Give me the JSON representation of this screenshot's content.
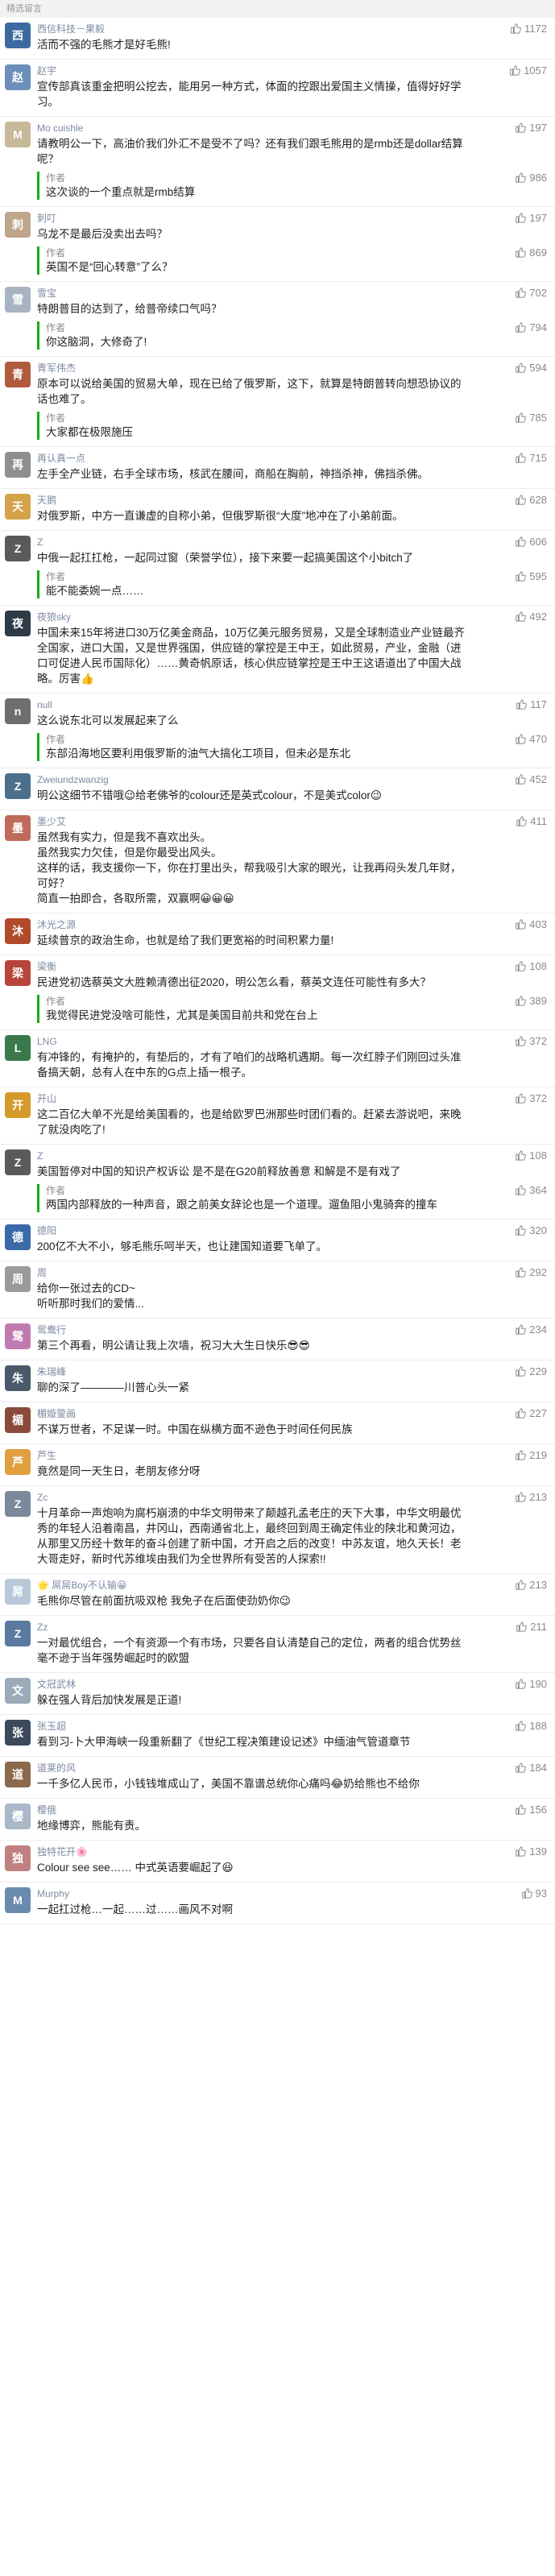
{
  "header": {
    "title": "精选留言"
  },
  "comments": [
    {
      "name": "西信科技－果毅",
      "text": "活而不强的毛熊才是好毛熊!",
      "likes": "1172",
      "avatar_color": "#3d6a9e",
      "avatar_char": "西",
      "reply": null
    },
    {
      "name": "赵宇",
      "text": "宣传部真该重金把明公挖去，能用另一种方式，体面的控跟出爱国主义情操，值得好好学习。",
      "likes": "1057",
      "avatar_color": "#6b8fb8",
      "avatar_char": "赵",
      "reply": null
    },
    {
      "name": "Mo cuishle",
      "text": "请教明公一下，高油价我们外汇不是受不了吗？还有我们跟毛熊用的是rmb还是dollar结算呢？",
      "likes": "197",
      "avatar_color": "#c8b89a",
      "avatar_char": "M",
      "reply": {
        "author": "作者",
        "text": "这次谈的一个重点就是rmb结算",
        "likes": "986"
      }
    },
    {
      "name": "刺叮",
      "text": "乌龙不是最后没卖出去吗？",
      "likes": "197",
      "avatar_color": "#bfa68a",
      "avatar_char": "刺",
      "reply": {
        "author": "作者",
        "text": "英国不是“回心转意”了么？",
        "likes": "869"
      }
    },
    {
      "name": "雪宝",
      "text": "特朗普目的达到了，给普帝续口气吗？",
      "likes": "702",
      "avatar_color": "#a8b4c4",
      "avatar_char": "雪",
      "reply": {
        "author": "作者",
        "text": "你这脑洞，大修奇了!",
        "likes": "794"
      }
    },
    {
      "name": "青军伟杰",
      "text": "原本可以说给美国的贸易大单，现在已给了俄罗斯，这下，就算是特朗普转向想恐协议的话也难了。",
      "likes": "594",
      "avatar_color": "#b25a3c",
      "avatar_char": "青",
      "reply": {
        "author": "作者",
        "text": "大家都在极限施压",
        "likes": "785"
      }
    },
    {
      "name": "再认真一点",
      "text": "左手全产业链，右手全球市场，核武在腰间，商船在胸前，神挡杀神，佛挡杀佛。",
      "likes": "715",
      "avatar_color": "#8f8f8f",
      "avatar_char": "再",
      "reply": null
    },
    {
      "name": "天鹅",
      "text": "对俄罗斯，中方一直谦虚的自称小弟，但俄罗斯很“大度”地冲在了小弟前面。",
      "likes": "628",
      "avatar_color": "#d4a24a",
      "avatar_char": "天",
      "reply": null
    },
    {
      "name": "Z",
      "text": "中俄一起扛扛枪，一起同过窗（荣誉学位），接下来要一起搞美国这个小bitch了",
      "likes": "606",
      "avatar_color": "#5a5a5a",
      "avatar_char": "Z",
      "reply": {
        "author": "作者",
        "text": "能不能委婉一点……",
        "likes": "595"
      }
    },
    {
      "name": "夜狼sky",
      "text": "中国未来15年将进口30万亿美金商品，10万亿美元服务贸易，又是全球制造业产业链最齐全国家，进口大国，又是世界强国，供应链的掌控是王中王，如此贸易，产业，金融（进口可促进人民币国际化）……黄奇帆原话，核心供应链掌控是王中王这语道出了中国大战略。厉害👍",
      "likes": "492",
      "avatar_color": "#2f3a48",
      "avatar_char": "夜",
      "reply": null
    },
    {
      "name": "null",
      "text": "这么说东北可以发展起来了么",
      "likes": "117",
      "avatar_color": "#6e6e6e",
      "avatar_char": "n",
      "reply": {
        "author": "作者",
        "text": "东部沿海地区要利用俄罗斯的油气大搞化工项目，但未必是东北",
        "likes": "470"
      }
    },
    {
      "name": "Zweiundzwanzig",
      "text": "明公这细节不错哦😉给老佛爷的colour还是英式colour，不是美式color😉",
      "likes": "452",
      "avatar_color": "#4c6f8c",
      "avatar_char": "Z",
      "reply": null
    },
    {
      "name": "墨少艾",
      "text": "虽然我有实力，但是我不喜欢出头。\n虽然我实力欠佳，但是你最受出风头。\n这样的话，我支援你一下，你在打里出头，帮我吸引大家的眼光，让我再闷头发几年财，可好？\n简直一拍即合，各取所需，双赢啊😀😀😀",
      "likes": "411",
      "avatar_color": "#c06a5a",
      "avatar_char": "墨",
      "reply": null
    },
    {
      "name": "沐光之源",
      "text": "延续普京的政治生命，也就是给了我们更宽裕的时间积累力量!",
      "likes": "403",
      "avatar_color": "#b04a2a",
      "avatar_char": "沐",
      "reply": null
    },
    {
      "name": "梁衡",
      "text": "民进党初选蔡英文大胜赖清德出征2020，明公怎么看，蔡英文连任可能性有多大？",
      "likes": "108",
      "avatar_color": "#b8453a",
      "avatar_char": "梁",
      "reply": {
        "author": "作者",
        "text": "我觉得民进党没啥可能性，尤其是美国目前共和党在台上",
        "likes": "389"
      }
    },
    {
      "name": "LNG",
      "text": "有冲锋的，有掩护的，有垫后的，才有了咱们的战略机遇期。每一次红脖子们刚回过头准备搞天朝，总有人在中东的G点上插一根子。",
      "likes": "372",
      "avatar_color": "#3a7a4a",
      "avatar_char": "L",
      "reply": null
    },
    {
      "name": "开山",
      "text": "这二百亿大单不光是给美国看的，也是给欧罗巴洲那些时团们看的。赶紧去游说吧，来晚了就没肉吃了!",
      "likes": "372",
      "avatar_color": "#d49a2a",
      "avatar_char": "开",
      "reply": null
    },
    {
      "name": "Z",
      "text": "美国暂停对中国的知识产权诉讼 是不是在G20前释放善意 和解是不是有戏了",
      "likes": "108",
      "avatar_color": "#5a5a5a",
      "avatar_char": "Z",
      "reply": {
        "author": "作者",
        "text": "两国内部释放的一种声音，跟之前美女辞论也是一个道理。遛鱼阻小鬼骑奔的撞车",
        "likes": "364"
      }
    },
    {
      "name": "德阳",
      "text": "200亿不大不小，够毛熊乐呵半天，也让建国知道要飞单了。",
      "likes": "320",
      "avatar_color": "#3a6aa8",
      "avatar_char": "德",
      "reply": null
    },
    {
      "name": "周",
      "text": "给你一张过去的CD~\n听听那时我们的爱情...",
      "likes": "292",
      "avatar_color": "#9a9a9a",
      "avatar_char": "周",
      "reply": null
    },
    {
      "name": "鸳鸯行",
      "text": "第三个再看，明公请让我上次墙，祝习大大生日快乐😎😎",
      "likes": "234",
      "avatar_color": "#c07ab0",
      "avatar_char": "鸳",
      "reply": null
    },
    {
      "name": "朱瑞峰",
      "text": "聊的深了————川普心头一紧",
      "likes": "229",
      "avatar_color": "#4a5a6a",
      "avatar_char": "朱",
      "reply": null
    },
    {
      "name": "楣嫙蓥画",
      "text": "不谋万世者，不足谋一时。中国在纵横方面不逊色于时间任何民族",
      "likes": "227",
      "avatar_color": "#8a4a3a",
      "avatar_char": "楣",
      "reply": null
    },
    {
      "name": "芦生",
      "text": "竟然是同一天生日，老朋友修分呀",
      "likes": "219",
      "avatar_color": "#e0a040",
      "avatar_char": "芦",
      "reply": null
    },
    {
      "name": "Zc",
      "text": "十月革命一声炮响为腐朽崩溃的中华文明带来了颠越孔孟老庄的天下大事，中华文明最优秀的年轻人沿着南昌，井冈山，西南通省北上，最终回到周王确定伟业的陕北和黄河边，从那里又历经十数年的奋斗创建了新中国，才开启之后的改变！中苏友谊，地久天长！老大哥走好，新时代苏维埃由我们为全世界所有受苦的人探索!!",
      "likes": "213",
      "avatar_color": "#7a8a9a",
      "avatar_char": "Z",
      "reply": null
    },
    {
      "name": "🌟 屌屌Boy不认输😀",
      "text": "毛熊你尽管在前面抗吸双枪 我免子在后面使劲奶你😉",
      "likes": "213",
      "avatar_color": "#b8c8d8",
      "avatar_char": "屌",
      "reply": null
    },
    {
      "name": "Zz",
      "text": "一对最优组合，一个有资源一个有市场，只要各自认清楚自己的定位，两者的组合优势丝毫不逊于当年强势崛起时的欧盟",
      "likes": "211",
      "avatar_color": "#5a7aa0",
      "avatar_char": "Z",
      "reply": null
    },
    {
      "name": "文冠武林",
      "text": "躲在强人背后加快发展是正道!",
      "likes": "190",
      "avatar_color": "#9aaab8",
      "avatar_char": "文",
      "reply": null
    },
    {
      "name": "张玉超",
      "text": "看到习-卜大甲海峡一段重新翻了《世纪工程决策建设记述》中缅油气管道章节",
      "likes": "188",
      "avatar_color": "#3a4a5a",
      "avatar_char": "张",
      "reply": null
    },
    {
      "name": "道莱的风",
      "text": "一千多亿人民币，小钱钱堆成山了，美国不靠谱总统你心痛吗😂奶给熊也不给你",
      "likes": "184",
      "avatar_color": "#8a6a4a",
      "avatar_char": "道",
      "reply": null
    },
    {
      "name": "樱俄",
      "text": "地缘博弈，熊能有责。",
      "likes": "156",
      "avatar_color": "#a8b8c8",
      "avatar_char": "樱",
      "reply": null
    },
    {
      "name": "独特花开🌸",
      "text": "Colour see see…… 中式英语要崛起了😆",
      "likes": "139",
      "avatar_color": "#c08080",
      "avatar_char": "独",
      "reply": null
    },
    {
      "name": "Murphy",
      "text": "一起扛过枪…一起……过……画风不对啊",
      "likes": "93",
      "avatar_color": "#6a8ab0",
      "avatar_char": "M",
      "reply": null
    }
  ]
}
